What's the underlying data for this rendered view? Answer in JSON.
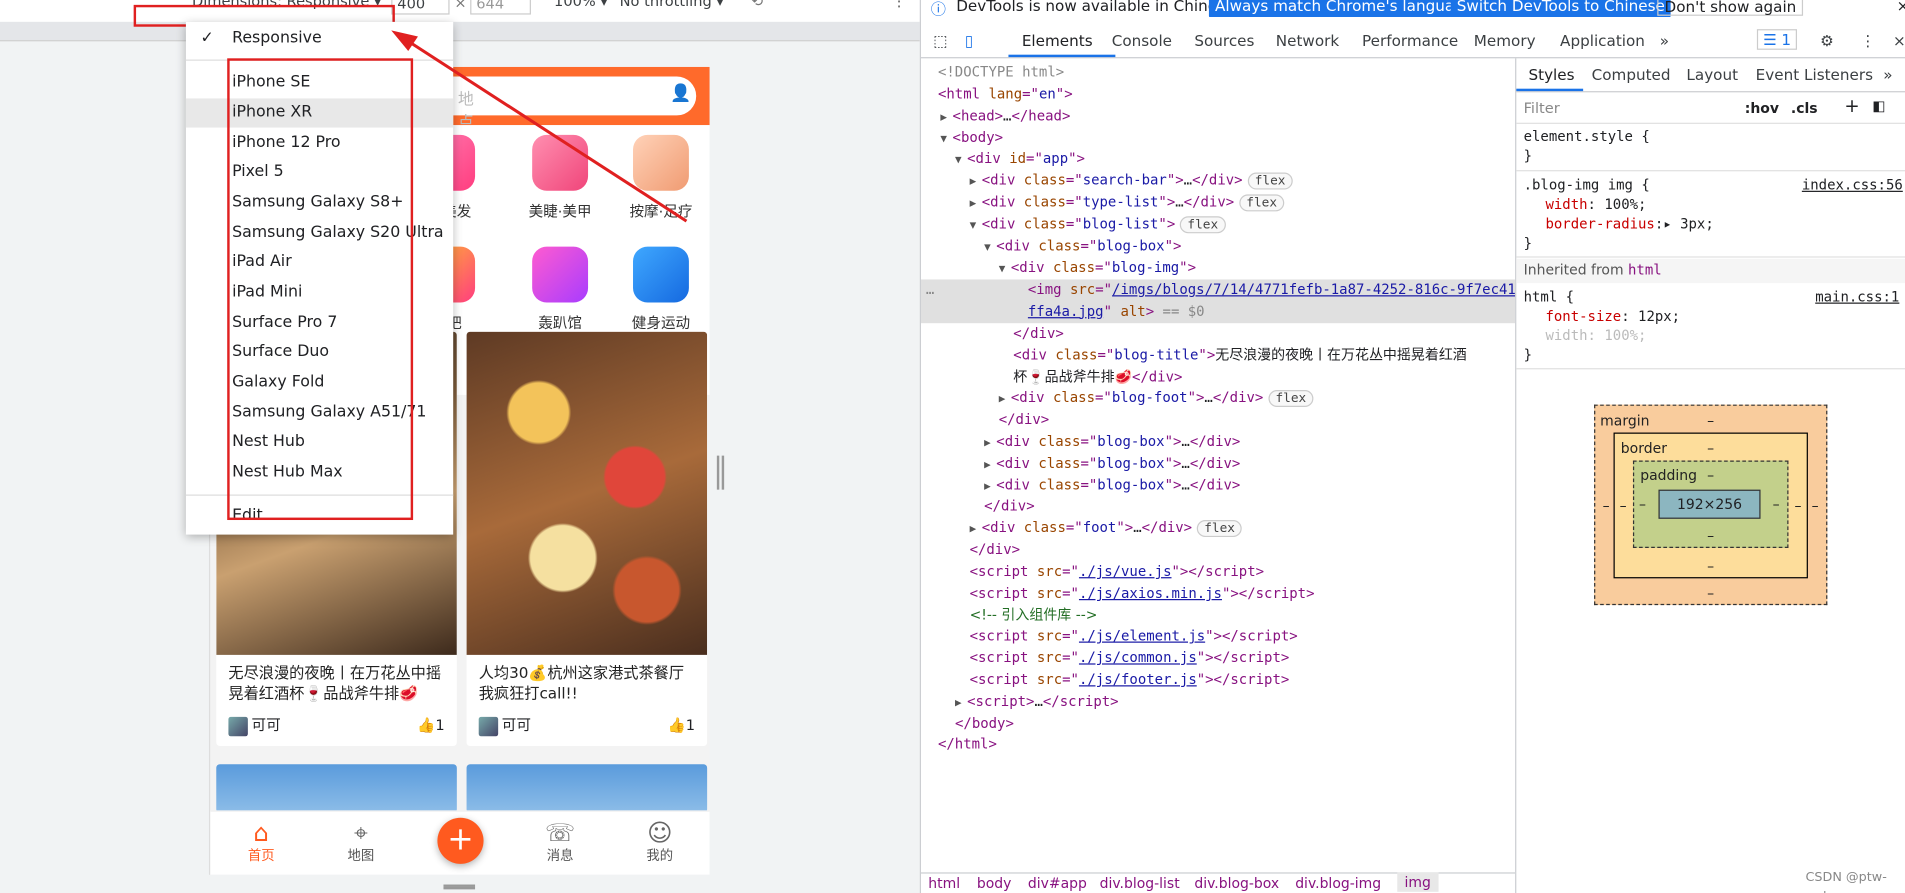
{
  "device_toolbar": {
    "dimensions": "Dimensions: Responsive ▾",
    "width": "400",
    "x": "×",
    "height": "644",
    "zoom": "100% ▾",
    "throttling": "No throttling ▾"
  },
  "dropdown": {
    "checked": "✓",
    "items": [
      "Responsive",
      "iPhone SE",
      "iPhone XR",
      "iPhone 12 Pro",
      "Pixel 5",
      "Samsung Galaxy S8+",
      "Samsung Galaxy S20 Ultra",
      "iPad Air",
      "iPad Mini",
      "Surface Pro 7",
      "Surface Duo",
      "Galaxy Fold",
      "Samsung Galaxy A51/71",
      "Nest Hub",
      "Nest Hub Max",
      "Edit..."
    ]
  },
  "app": {
    "search_placeholder": "地点",
    "types": [
      "人·美发",
      "美睫·美甲",
      "按摩·足疗",
      "酒吧",
      "轰趴馆",
      "健身运动"
    ],
    "blogs": [
      {
        "title": "无尽浪漫的夜晚丨在万花丛中摇晃着红酒杯🍷品战斧牛排🥩",
        "user": "可可",
        "likes": "1"
      },
      {
        "title": "人均30💰杭州这家港式茶餐厅我疯狂打call!!",
        "user": "可可",
        "likes": "1"
      }
    ],
    "tabs": [
      "首页",
      "地图",
      "消息",
      "我的"
    ],
    "plus": "+",
    "accent": "#ff6a2b"
  },
  "devtools": {
    "infobar": {
      "text": "DevTools is now available in Chinese!",
      "btn1": "Always match Chrome's language",
      "btn2": "Switch DevTools to Chinese",
      "btn3": "Don't show again"
    },
    "tabs": [
      "Elements",
      "Console",
      "Sources",
      "Network",
      "Performance",
      "Memory",
      "Application"
    ],
    "issues": "1",
    "style_tabs": [
      "Styles",
      "Computed",
      "Layout",
      "Event Listeners"
    ],
    "filter_placeholder": "Filter",
    "hov": ":hov",
    "cls": ".cls",
    "breadcrumb": [
      "html",
      "body",
      "div#app",
      "div.blog-list",
      "div.blog-box",
      "div.blog-img",
      "img"
    ],
    "watermark": "CSDN @ptw-cwl",
    "boxmodel": {
      "margin": "margin",
      "border": "border",
      "padding": "padding",
      "content": "192×256",
      "dash": "–"
    }
  }
}
